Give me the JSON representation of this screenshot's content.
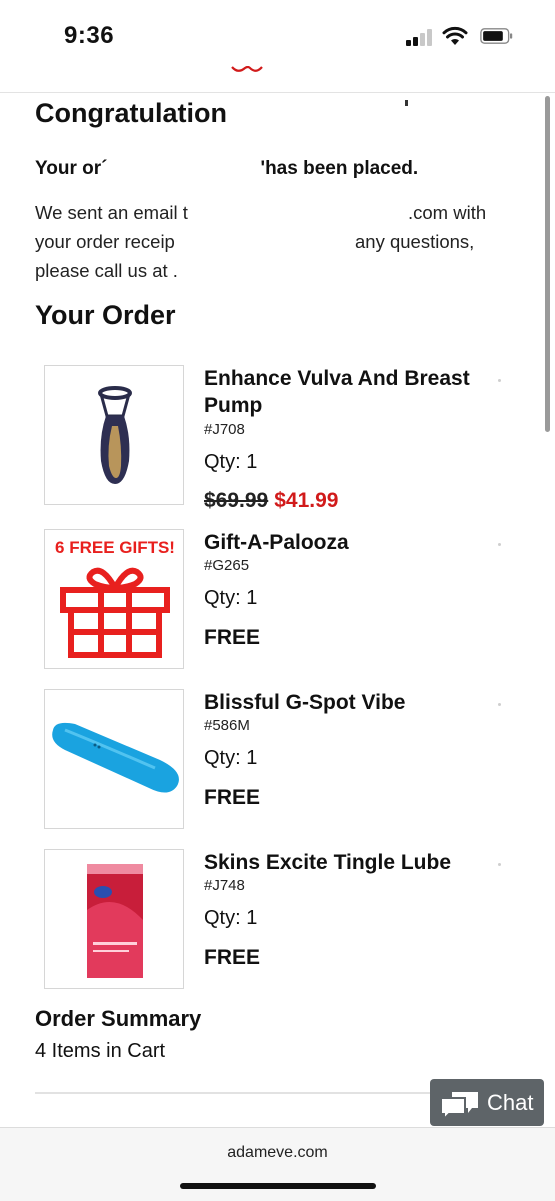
{
  "status_bar": {
    "time": "9:36"
  },
  "confirmation": {
    "heading": "Congratulation",
    "order_placed": "Your or´                             'has been placed.",
    "email_line1": "We sent an email t",
    "email_line1_end": ".com with",
    "email_line2": "your order receip",
    "email_line2_end": "any questions,",
    "email_line3": "please call us at ."
  },
  "order": {
    "heading": "Your Order",
    "items": [
      {
        "name": "Enhance Vulva And Breast Pump",
        "sku": "#J708",
        "qty": "Qty: 1",
        "price_original": "$69.99",
        "price_sale": "$41.99",
        "image": "pump-product-image"
      },
      {
        "name": "Gift-A-Palooza",
        "sku": "#G265",
        "qty": "Qty: 1",
        "price": "FREE",
        "image": "gift-box-icon",
        "image_text": "6 FREE GIFTS!"
      },
      {
        "name": "Blissful G-Spot Vibe",
        "sku": "#586M",
        "qty": "Qty: 1",
        "price": "FREE",
        "image": "vibe-product-image"
      },
      {
        "name": "Skins Excite Tingle Lube",
        "sku": "#J748",
        "qty": "Qty: 1",
        "price": "FREE",
        "image": "lube-product-image"
      }
    ]
  },
  "summary": {
    "title": "Order Summary",
    "items_count": "4 Items in Cart"
  },
  "chat": {
    "label": "Chat"
  },
  "browser": {
    "url": "adameve.com"
  },
  "colors": {
    "sale_red": "#d11a1a",
    "chat_bg": "#5e6468",
    "gift_red": "#e8201e",
    "vibe_blue": "#1aa3e0"
  }
}
